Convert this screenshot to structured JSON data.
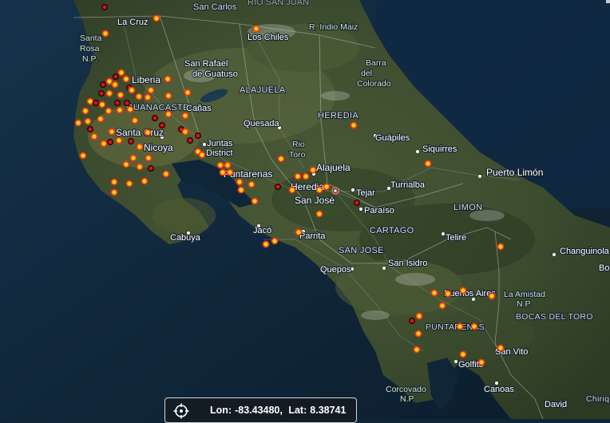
{
  "map": {
    "top_labels": [
      "San Carlos",
      "RIO SAN JUAN"
    ],
    "places": [
      {
        "name": "La Cruz"
      },
      {
        "name": "Santa Rosa N.P."
      },
      {
        "name": "Los Chiles"
      },
      {
        "name": "R. Indio Maiz"
      },
      {
        "name": "Liberia"
      },
      {
        "name": "San Rafael de Guatuso"
      },
      {
        "name": "Barra del Colorado"
      },
      {
        "name": "ALAJUELA"
      },
      {
        "name": "GUANACASTE"
      },
      {
        "name": "Cañas"
      },
      {
        "name": "HEREDIA"
      },
      {
        "name": "Quesada"
      },
      {
        "name": "Santa Cruz"
      },
      {
        "name": "Guápiles"
      },
      {
        "name": "Siquirres"
      },
      {
        "name": "Nicoya"
      },
      {
        "name": "Juntas District"
      },
      {
        "name": "Rio Toro"
      },
      {
        "name": "Alajuela"
      },
      {
        "name": "Puerto Limón"
      },
      {
        "name": "Puntarenas"
      },
      {
        "name": "Heredia"
      },
      {
        "name": "Tejar"
      },
      {
        "name": "Turrialba"
      },
      {
        "name": "San José"
      },
      {
        "name": "Paraíso"
      },
      {
        "name": "LIMON"
      },
      {
        "name": "Cabuya"
      },
      {
        "name": "Jacó"
      },
      {
        "name": "Parrita"
      },
      {
        "name": "CARTAGO"
      },
      {
        "name": "Telire"
      },
      {
        "name": "SAN JOSE"
      },
      {
        "name": "Changuinola"
      },
      {
        "name": "San Isidro"
      },
      {
        "name": "Quepos"
      },
      {
        "name": "Buenos Aires"
      },
      {
        "name": "La Amistad N.P."
      },
      {
        "name": "BOCAS DEL TORO"
      },
      {
        "name": "PUNTARENAS"
      },
      {
        "name": "San Vito"
      },
      {
        "name": "Golfito"
      },
      {
        "name": "Corcovado N.P."
      },
      {
        "name": "Canoas"
      },
      {
        "name": "David"
      },
      {
        "name": "Chiriqui"
      },
      {
        "name": "Bo"
      }
    ],
    "hotspot_colors": {
      "yellow_fill": "#ffd21a",
      "yellow_ring": "#e8351a",
      "red_fill": "#d8141a"
    }
  },
  "coordinates": {
    "lon_label": "Lon:",
    "lon_value": "-83.43480,",
    "lat_label": "Lat:",
    "lat_value": "8.38741",
    "icon": "crosshair-icon"
  }
}
